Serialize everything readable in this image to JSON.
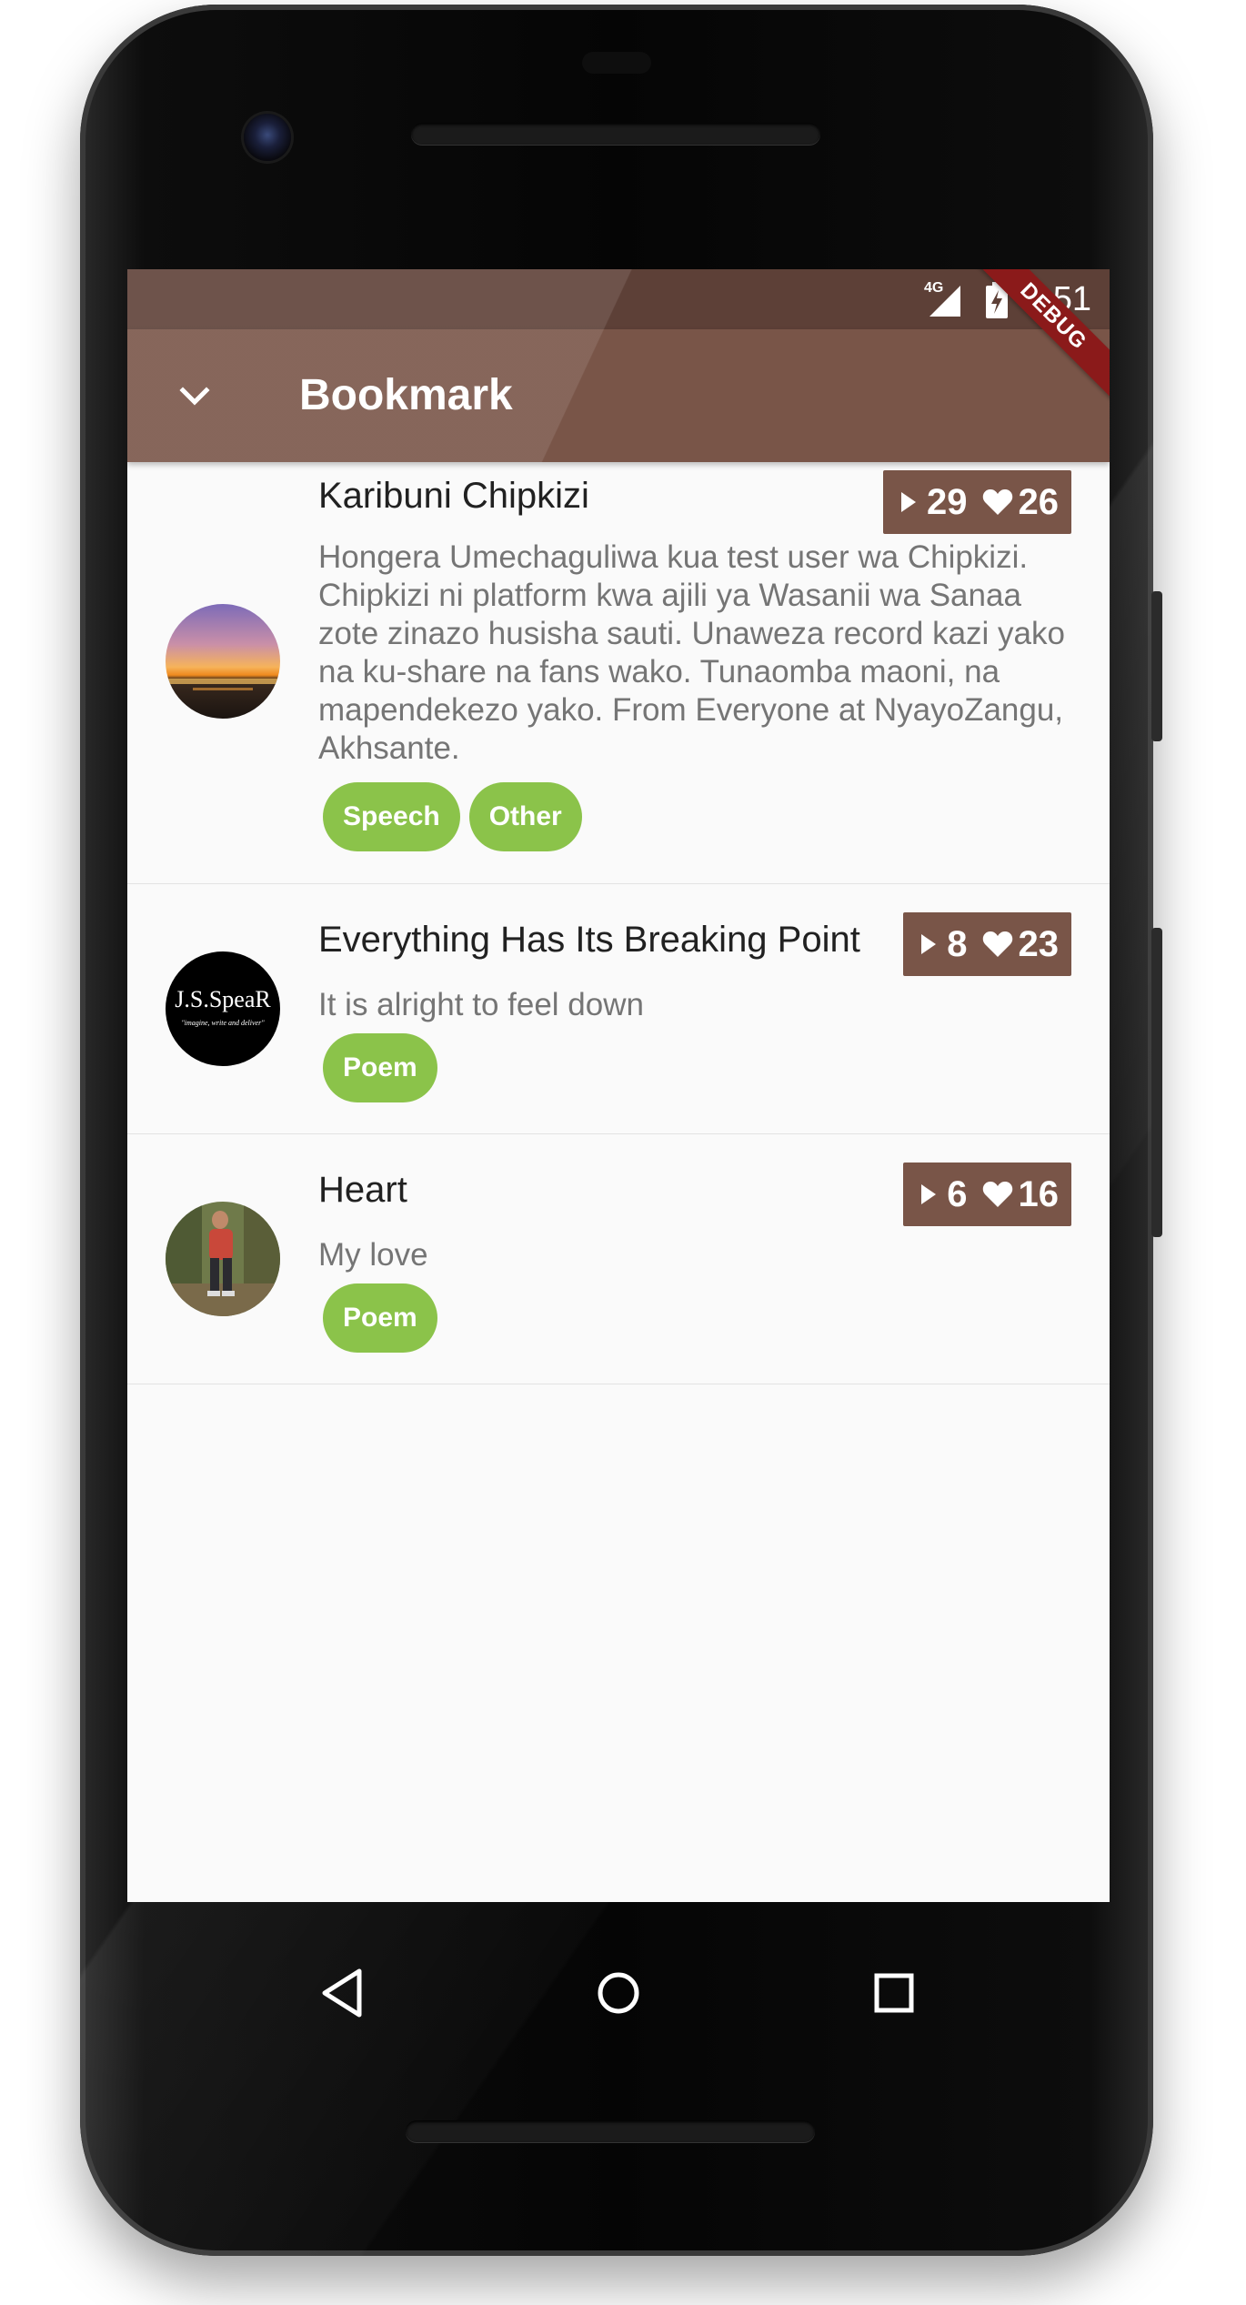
{
  "statusbar": {
    "time": "8:51",
    "network": "4G"
  },
  "banner": {
    "text": "DEBUG"
  },
  "appbar": {
    "title": "Bookmark"
  },
  "items": [
    {
      "title": "Karibuni Chipkizi",
      "description": "Hongera Umechaguliwa kua test user wa Chipkizi. Chipkizi ni platform kwa ajili ya Wasanii wa Sanaa zote zinazo husisha sauti. Unaweza record kazi yako na ku-share na fans wako.  Tunaomba maoni, na mapendekezo yako. From Everyone at NyayoZangu, Akhsante.",
      "plays": "29",
      "likes": "26",
      "tags": [
        "Speech",
        "Other"
      ]
    },
    {
      "title": "Everything Has Its Breaking Point",
      "description": "It is alright to feel down",
      "plays": "8",
      "likes": "23",
      "tags": [
        "Poem"
      ],
      "avatar_text": "J.S.SpeaR",
      "avatar_subtext": "\"imagine, write and deliver\""
    },
    {
      "title": "Heart",
      "description": "My love",
      "plays": "6",
      "likes": "16",
      "tags": [
        "Poem"
      ]
    }
  ],
  "colors": {
    "primary": "#795548",
    "primary_dark": "#5d4037",
    "chip": "#8bc34a",
    "debug": "#8b1a1a"
  },
  "icons": [
    "back-chevron-icon",
    "signal-icon",
    "battery-icon",
    "play-icon",
    "heart-icon",
    "nav-back-icon",
    "nav-home-icon",
    "nav-recents-icon"
  ]
}
